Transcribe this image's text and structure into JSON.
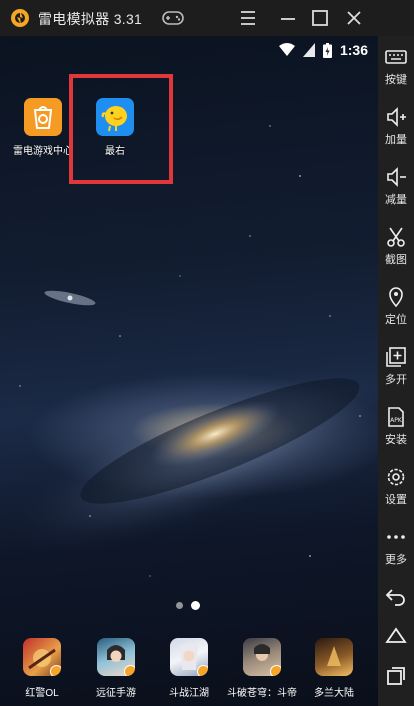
{
  "titlebar": {
    "title": "雷电模拟器 3.31"
  },
  "statusbar": {
    "time": "1:36"
  },
  "home_apps": [
    {
      "label": "雷电游戏中心",
      "icon": "leidian-game-center-icon",
      "color": "#f59a23"
    },
    {
      "label": "最右",
      "icon": "zuiyou-chick-icon",
      "color": "#1e8ef0"
    }
  ],
  "pager": {
    "pages": 2,
    "current": 2
  },
  "dock_apps": [
    {
      "label": "红警OL",
      "icon": "hongjing-ol-icon"
    },
    {
      "label": "远征手游",
      "icon": "yuanzheng-icon"
    },
    {
      "label": "斗战江湖",
      "icon": "douzhan-jianghu-icon"
    },
    {
      "label": "斗破苍穹：斗帝",
      "icon": "doupo-cangqiong-icon"
    },
    {
      "label": "多兰大陆",
      "icon": "duolan-dalu-icon"
    }
  ],
  "sidebar": {
    "items": [
      {
        "label": "按键",
        "icon": "keyboard-icon"
      },
      {
        "label": "加量",
        "icon": "volume-up-icon"
      },
      {
        "label": "减量",
        "icon": "volume-down-icon"
      },
      {
        "label": "截图",
        "icon": "scissors-icon"
      },
      {
        "label": "定位",
        "icon": "location-pin-icon"
      },
      {
        "label": "多开",
        "icon": "multi-instance-icon"
      },
      {
        "label": "安装",
        "icon": "apk-install-icon"
      },
      {
        "label": "设置",
        "icon": "gear-icon"
      },
      {
        "label": "更多",
        "icon": "more-dots-icon"
      }
    ]
  },
  "colors": {
    "highlight": "#e0383a",
    "sidebar_bg": "#202020",
    "titlebar_bg": "#1d1d1d"
  }
}
